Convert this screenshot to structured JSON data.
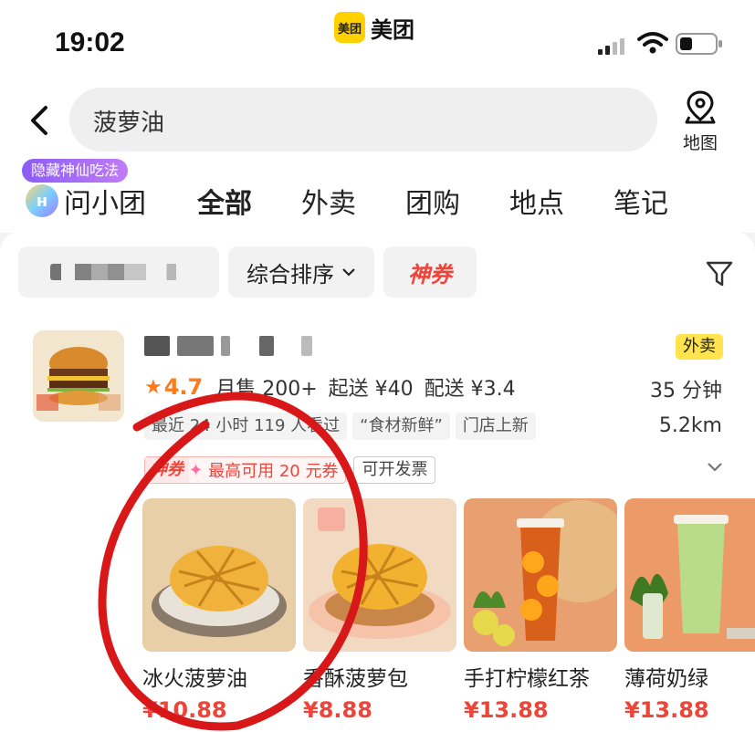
{
  "status_bar": {
    "time": "19:02",
    "brand_logo_text": "美团",
    "brand_name": "美团"
  },
  "search": {
    "query": "菠萝油",
    "map_label": "地图"
  },
  "tabs": {
    "promo_tag": "隐藏神仙吃法",
    "ask_label": "问小团",
    "items": [
      "全部",
      "外卖",
      "团购",
      "地点",
      "笔记"
    ],
    "active": "全部"
  },
  "filters": {
    "sort_label": "综合排序",
    "coupon_label": "神券"
  },
  "shop": {
    "badge": "外卖",
    "rating": "4.7",
    "monthly_sales": "月售 200+",
    "min_order": "起送 ¥40",
    "delivery_fee": "配送 ¥3.4",
    "eta": "35 分钟",
    "distance": "5.2km",
    "tags": [
      "最近 24 小时 119 人看过",
      "“食材新鲜”",
      "门店上新"
    ],
    "coupon_brand": "神券",
    "coupon_text": "最高可用 20 元券",
    "invoice": "可开发票"
  },
  "products": [
    {
      "name": "冰火菠萝油",
      "price": "¥10.88"
    },
    {
      "name": "香酥菠萝包",
      "price": "¥8.88"
    },
    {
      "name": "手打柠檬红茶",
      "price": "¥13.88"
    },
    {
      "name": "薄荷奶绿",
      "price": "¥13.88"
    }
  ],
  "colors": {
    "accent_yellow": "#ffd100",
    "price_red": "#f0433a",
    "rating_orange": "#ff7a1a",
    "annotation_red": "#d81818"
  }
}
